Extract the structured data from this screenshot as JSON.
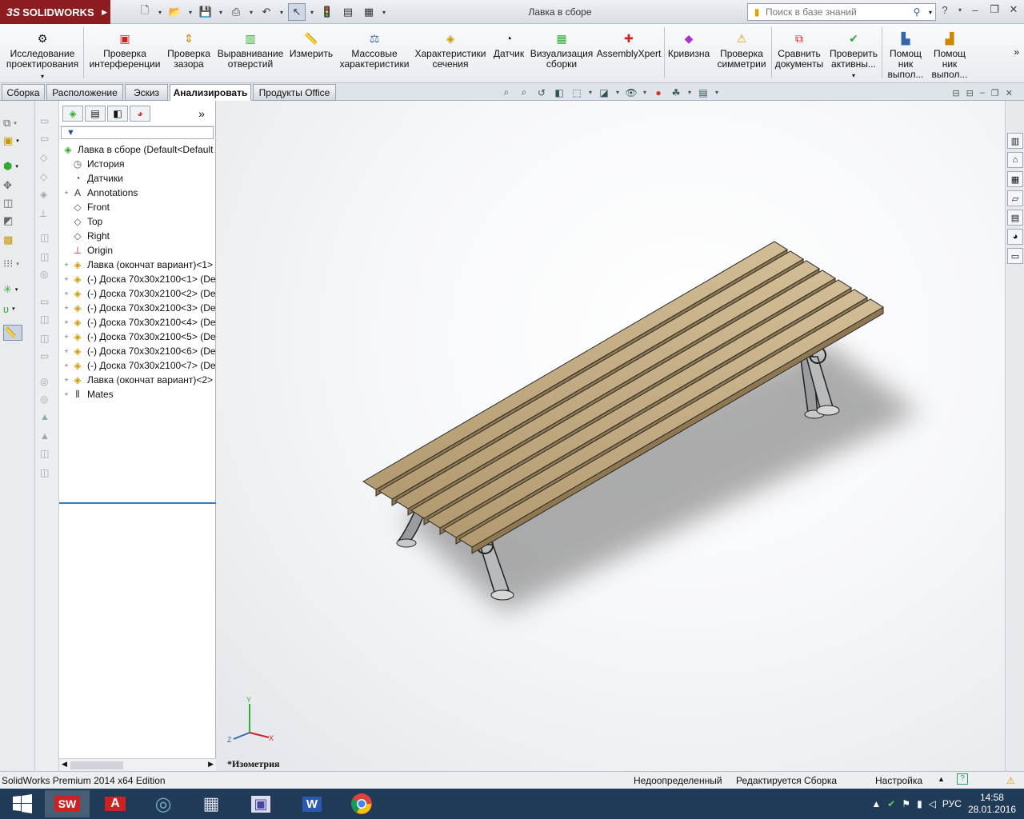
{
  "app": {
    "logo": "SOLIDWORKS",
    "title": "Лавка в сборе"
  },
  "search": {
    "placeholder": "Поиск в базе знаний"
  },
  "ribbon": [
    {
      "label": "Исследование\nпроектирования",
      "icon": "design-study-icon"
    },
    {
      "label": "Проверка\nинтерференции",
      "icon": "interference-icon"
    },
    {
      "label": "Проверка\nзазора",
      "icon": "clearance-icon"
    },
    {
      "label": "Выравнивание\nотверстий",
      "icon": "hole-alignment-icon"
    },
    {
      "label": "Измерить",
      "icon": "measure-icon"
    },
    {
      "label": "Массовые\nхарактеристики",
      "icon": "mass-properties-icon"
    },
    {
      "label": "Характеристики\nсечения",
      "icon": "section-properties-icon"
    },
    {
      "label": "Датчик",
      "icon": "sensor-icon"
    },
    {
      "label": "Визуализация\nсборки",
      "icon": "assembly-visualization-icon"
    },
    {
      "label": "AssemblyXpert",
      "icon": "assemblyxpert-icon"
    },
    {
      "label": "Кривизна",
      "icon": "curvature-icon"
    },
    {
      "label": "Проверка\nсимметрии",
      "icon": "symmetry-check-icon"
    },
    {
      "label": "Сравнить\nдокументы",
      "icon": "compare-documents-icon"
    },
    {
      "label": "Проверить\nактивны...",
      "icon": "check-active-icon"
    },
    {
      "label": "Помощ\nник\nвыпол...",
      "icon": "assistant-icon"
    },
    {
      "label": "Помощ\nник\nвыпол...",
      "icon": "assistant2-icon"
    }
  ],
  "tabs": [
    "Сборка",
    "Расположение",
    "Эскиз",
    "Анализировать",
    "Продукты Office"
  ],
  "tree": {
    "root": "Лавка в сборе  (Default<Default",
    "items": [
      {
        "label": "История",
        "icon": "history-icon",
        "expand": ""
      },
      {
        "label": "Датчики",
        "icon": "sensors-icon",
        "expand": ""
      },
      {
        "label": "Annotations",
        "icon": "annotations-icon",
        "expand": "+"
      },
      {
        "label": "Front",
        "icon": "plane-icon",
        "expand": ""
      },
      {
        "label": "Top",
        "icon": "plane-icon",
        "expand": ""
      },
      {
        "label": "Right",
        "icon": "plane-icon",
        "expand": ""
      },
      {
        "label": "Origin",
        "icon": "origin-icon",
        "expand": ""
      },
      {
        "label": "Лавка (окончат вариант)<1>",
        "icon": "subassembly-icon",
        "expand": "+"
      },
      {
        "label": "(-) Доска 70x30x2100<1> (De",
        "icon": "part-icon",
        "expand": "+"
      },
      {
        "label": "(-) Доска 70x30x2100<2> (De",
        "icon": "part-icon",
        "expand": "+"
      },
      {
        "label": "(-) Доска 70x30x2100<3> (De",
        "icon": "part-icon",
        "expand": "+"
      },
      {
        "label": "(-) Доска 70x30x2100<4> (De",
        "icon": "part-icon",
        "expand": "+"
      },
      {
        "label": "(-) Доска 70x30x2100<5> (De",
        "icon": "part-icon",
        "expand": "+"
      },
      {
        "label": "(-) Доска 70x30x2100<6> (De",
        "icon": "part-icon",
        "expand": "+"
      },
      {
        "label": "(-) Доска 70x30x2100<7> (De",
        "icon": "part-icon",
        "expand": "+"
      },
      {
        "label": "Лавка (окончат вариант)<2>",
        "icon": "subassembly-icon",
        "expand": "+"
      },
      {
        "label": "Mates",
        "icon": "mates-icon",
        "expand": "+"
      }
    ]
  },
  "viewport": {
    "view_label": "*Изометрия",
    "axes": {
      "x": "X",
      "y": "Y",
      "z": "Z"
    }
  },
  "status": {
    "edition": "SolidWorks Premium 2014 x64 Edition",
    "state": "Недоопределенный",
    "editing": "Редактируется Сборка",
    "units": "Настройка"
  },
  "taskbar": {
    "lang": "РУС",
    "time": "14:58",
    "date": "28.01.2016",
    "apps": [
      "windows-start-icon",
      "solidworks-icon",
      "autocad-icon",
      "explorer-icon",
      "calculator-icon",
      "floppy-save-icon",
      "word-icon",
      "chrome-icon"
    ]
  },
  "colors": {
    "accent": "#8d1c20",
    "wood": "#c2aa82",
    "taskbar": "#1f3b57"
  }
}
